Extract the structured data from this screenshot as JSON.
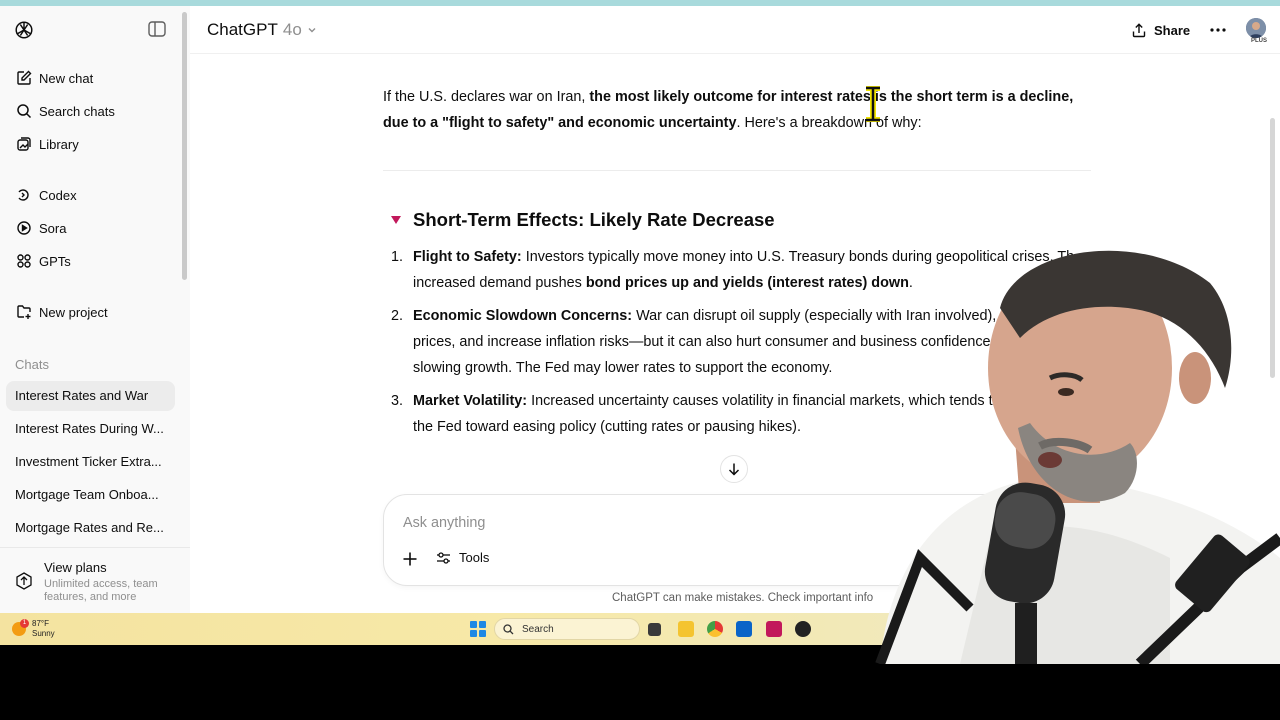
{
  "app": {
    "model_name": "ChatGPT",
    "model_version": "4o",
    "share_label": "Share",
    "plan_badge": "PLUS"
  },
  "sidebar": {
    "nav": [
      {
        "label": "New chat",
        "icon": "new-chat-icon"
      },
      {
        "label": "Search chats",
        "icon": "search-icon"
      },
      {
        "label": "Library",
        "icon": "library-icon"
      },
      {
        "label": "Codex",
        "icon": "codex-icon"
      },
      {
        "label": "Sora",
        "icon": "sora-icon"
      },
      {
        "label": "GPTs",
        "icon": "gpts-icon"
      },
      {
        "label": "New project",
        "icon": "new-project-icon"
      }
    ],
    "section_label": "Chats",
    "chats": [
      "Interest Rates and War",
      "Interest Rates During W...",
      "Investment Ticker Extra...",
      "Mortgage Team Onboa...",
      "Mortgage Rates and Re..."
    ],
    "plans": {
      "title": "View plans",
      "subtitle": "Unlimited access, team features, and more"
    }
  },
  "message": {
    "intro_plain_1": "If the U.S. declares war on Iran, ",
    "intro_bold": "the most likely outcome for interest rates is the short term is a decline, due to a \"flight to safety\" and economic uncertainty",
    "intro_plain_2": ". Here's a breakdown of why:",
    "section_heading": "Short-Term Effects: Likely Rate Decrease",
    "items": [
      {
        "number": "1.",
        "title": "Flight to Safety:",
        "text_1": " Investors typically move money into U.S. Treasury bonds during geopolitical crises. Th",
        "text_2": "increased demand pushes ",
        "bold_2": "bond prices up and yields (interest rates) down",
        "text_3": "."
      },
      {
        "number": "2.",
        "title": "Economic Slowdown Concerns:",
        "text_1": " War can disrupt oil supply (especially with Iran involved), spike e",
        "text_2": "prices, and increase inflation risks—but it can also hurt consumer and business confidence, pot",
        "text_3": "slowing growth. The Fed may lower rates to support the economy."
      },
      {
        "number": "3.",
        "title": "Market Volatility:",
        "text_1": " Increased uncertainty causes volatility in financial markets, which tends to pr",
        "text_2": "the Fed toward easing policy (cutting rates or pausing hikes)."
      }
    ]
  },
  "composer": {
    "placeholder": "Ask anything",
    "tools_label": "Tools"
  },
  "disclaimer": "ChatGPT can make mistakes. Check important info",
  "taskbar": {
    "weather_temp": "87°F",
    "weather_desc": "Sunny",
    "weather_badge": "1",
    "search_label": "Search"
  },
  "colors": {
    "accent_triangle": "#c2185b",
    "sidebar_bg": "#f9f9f9",
    "active_item_bg": "#ececec",
    "taskbar_bg": "#f4e3a0"
  }
}
